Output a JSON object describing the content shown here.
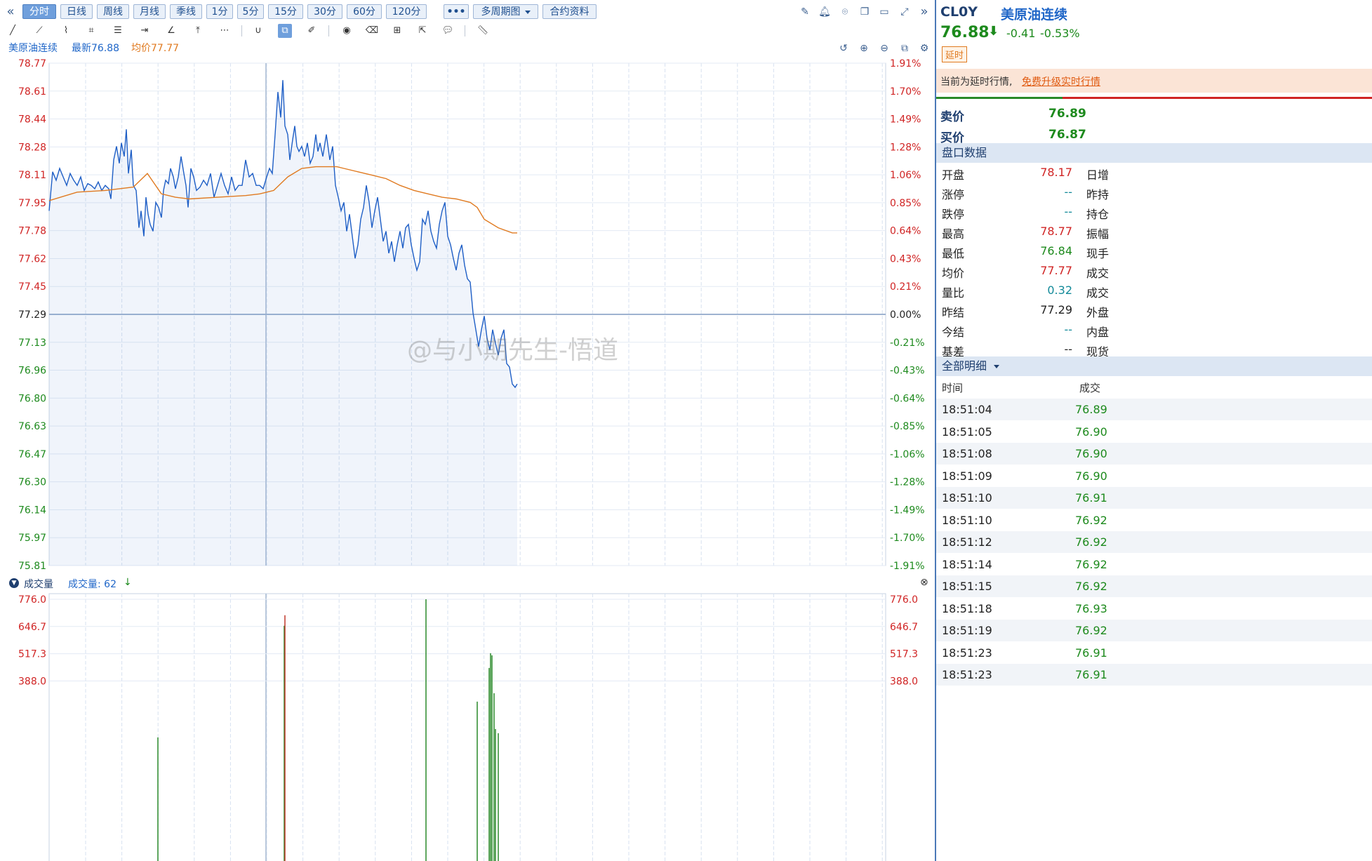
{
  "toolbar": {
    "periods": [
      "分时",
      "日线",
      "周线",
      "月线",
      "季线",
      "1分",
      "5分",
      "15分",
      "30分",
      "60分",
      "120分"
    ],
    "active_period": "分时",
    "more_label": "•••",
    "multi_period_label": "多周期图",
    "contract_info_label": "合约资料",
    "collapse_glyph": "«",
    "expand_glyph": "»"
  },
  "legend": {
    "symbol_name": "美原油连续",
    "latest_label": "最新76.88",
    "avg_label": "均价77.77"
  },
  "price_axis": {
    "left": [
      "78.77",
      "78.61",
      "78.44",
      "78.28",
      "78.11",
      "77.95",
      "77.78",
      "77.62",
      "77.45",
      "77.29",
      "77.13",
      "76.96",
      "76.80",
      "76.63",
      "76.47",
      "76.30",
      "76.14",
      "75.97",
      "75.81"
    ],
    "right": [
      "1.91%",
      "1.70%",
      "1.49%",
      "1.28%",
      "1.06%",
      "0.85%",
      "0.64%",
      "0.43%",
      "0.21%",
      "0.00%",
      "-0.21%",
      "-0.43%",
      "-0.64%",
      "-0.85%",
      "-1.06%",
      "-1.28%",
      "-1.49%",
      "-1.70%",
      "-1.91%"
    ]
  },
  "volume": {
    "title": "成交量",
    "current_label": "成交量: 62",
    "axis_left": [
      "776.0",
      "646.7",
      "517.3",
      "388.0"
    ],
    "axis_right": [
      "776.0",
      "646.7",
      "517.3",
      "388.0"
    ]
  },
  "watermark": "@与小期先生-悟道",
  "chart_data": {
    "type": "line",
    "series": [
      {
        "name": "最新",
        "color": "#1f5fc6"
      },
      {
        "name": "均价",
        "color": "#e07a20"
      }
    ],
    "prev_settle": 77.29,
    "ylim": [
      75.81,
      78.77
    ],
    "price_x": [
      0,
      5,
      10,
      15,
      20,
      25,
      30,
      35,
      40,
      45,
      50,
      55,
      60,
      65,
      70,
      75,
      80,
      85,
      88,
      92,
      96,
      100,
      103,
      107,
      110,
      113,
      117,
      120,
      124,
      128,
      131,
      135,
      138,
      141,
      144,
      148,
      152,
      156,
      160,
      163,
      166,
      170,
      173,
      177,
      180,
      184,
      188,
      192,
      195,
      198,
      202,
      206,
      210,
      215,
      220,
      225,
      230,
      235,
      240,
      245,
      250,
      255,
      260,
      265,
      270,
      275,
      280,
      285,
      290,
      295,
      300,
      305,
      310,
      320,
      330,
      340,
      350,
      360,
      370,
      380,
      390,
      400,
      410,
      420,
      430,
      440,
      450,
      460,
      470,
      480,
      490,
      500,
      510,
      520,
      530,
      540,
      550,
      560,
      570,
      580,
      590,
      600,
      610,
      620,
      630,
      640,
      650,
      660,
      665
    ],
    "price": [
      77.9,
      78.13,
      78.08,
      78.15,
      78.1,
      78.05,
      78.12,
      78.08,
      78.05,
      78.1,
      78.02,
      78.06,
      78.05,
      78.03,
      78.07,
      78.02,
      78.05,
      78.03,
      77.97,
      78.2,
      78.28,
      78.18,
      78.3,
      78.22,
      78.38,
      78.12,
      78.26,
      78.05,
      78.02,
      77.8,
      77.9,
      77.75,
      77.98,
      77.88,
      77.82,
      77.78,
      77.95,
      77.92,
      77.86,
      78.02,
      78.08,
      78.06,
      78.15,
      78.1,
      78.03,
      78.1,
      78.22,
      78.12,
      78.05,
      77.92,
      78.15,
      78.1,
      78.02,
      78.04,
      78.08,
      78.05,
      78.12,
      77.98,
      78.05,
      78.12,
      78.05,
      78.0,
      78.1,
      78.02,
      78.05,
      78.05,
      78.2,
      78.1,
      78.12,
      78.05,
      78.05,
      78.03,
      78.05,
      78.02,
      78.05,
      78.03,
      78.08,
      78.02,
      78.05,
      78.1,
      78.05,
      78.2,
      78.12,
      78.05,
      78.03,
      78.0,
      77.95,
      77.9,
      77.85,
      77.8,
      77.75,
      77.7,
      77.68,
      77.65,
      77.6,
      77.55,
      77.5,
      77.45,
      77.4,
      77.3,
      77.2,
      77.1,
      77.0,
      76.95,
      76.9,
      76.88,
      76.86,
      76.88,
      76.88
    ],
    "price_detail": [
      [
        300,
        78.05
      ],
      [
        305,
        78.03
      ],
      [
        310,
        78.1
      ],
      [
        314,
        78.15
      ],
      [
        318,
        78.12
      ],
      [
        322,
        78.35
      ],
      [
        326,
        78.6
      ],
      [
        330,
        78.45
      ],
      [
        333,
        78.67
      ],
      [
        336,
        78.4
      ],
      [
        340,
        78.35
      ],
      [
        343,
        78.2
      ],
      [
        347,
        78.32
      ],
      [
        350,
        78.4
      ],
      [
        353,
        78.28
      ],
      [
        356,
        78.25
      ],
      [
        360,
        78.28
      ],
      [
        364,
        78.22
      ],
      [
        368,
        78.3
      ],
      [
        372,
        78.18
      ],
      [
        376,
        78.22
      ],
      [
        380,
        78.35
      ],
      [
        383,
        78.25
      ],
      [
        386,
        78.3
      ],
      [
        390,
        78.22
      ],
      [
        395,
        78.35
      ],
      [
        400,
        78.2
      ],
      [
        404,
        78.28
      ],
      [
        408,
        78.05
      ],
      [
        412,
        77.98
      ],
      [
        416,
        77.9
      ],
      [
        420,
        77.95
      ],
      [
        424,
        77.78
      ],
      [
        428,
        77.88
      ],
      [
        432,
        77.75
      ],
      [
        436,
        77.62
      ],
      [
        440,
        77.7
      ],
      [
        444,
        77.85
      ],
      [
        448,
        77.92
      ],
      [
        452,
        78.05
      ],
      [
        456,
        77.95
      ],
      [
        460,
        77.8
      ],
      [
        464,
        77.9
      ],
      [
        468,
        77.98
      ],
      [
        472,
        77.85
      ],
      [
        476,
        77.72
      ],
      [
        480,
        77.78
      ],
      [
        484,
        77.65
      ],
      [
        488,
        77.72
      ],
      [
        492,
        77.6
      ],
      [
        496,
        77.7
      ],
      [
        500,
        77.78
      ],
      [
        504,
        77.68
      ],
      [
        508,
        77.8
      ],
      [
        512,
        77.82
      ],
      [
        516,
        77.7
      ],
      [
        520,
        77.62
      ],
      [
        524,
        77.55
      ],
      [
        528,
        77.6
      ],
      [
        532,
        77.85
      ],
      [
        536,
        77.82
      ],
      [
        540,
        77.9
      ],
      [
        544,
        77.78
      ],
      [
        548,
        77.72
      ],
      [
        552,
        77.68
      ],
      [
        556,
        77.82
      ],
      [
        560,
        77.9
      ],
      [
        564,
        77.95
      ],
      [
        568,
        77.75
      ],
      [
        572,
        77.7
      ],
      [
        576,
        77.62
      ],
      [
        580,
        77.55
      ],
      [
        584,
        77.65
      ],
      [
        588,
        77.7
      ],
      [
        592,
        77.58
      ],
      [
        596,
        77.5
      ],
      [
        600,
        77.48
      ],
      [
        604,
        77.3
      ],
      [
        608,
        77.2
      ],
      [
        612,
        77.1
      ],
      [
        616,
        77.2
      ],
      [
        620,
        77.28
      ],
      [
        624,
        77.15
      ],
      [
        628,
        77.08
      ],
      [
        632,
        77.2
      ],
      [
        636,
        77.12
      ],
      [
        640,
        77.05
      ],
      [
        644,
        77.15
      ],
      [
        648,
        77.2
      ],
      [
        652,
        77.0
      ],
      [
        656,
        76.98
      ],
      [
        660,
        76.88
      ],
      [
        664,
        76.86
      ],
      [
        667,
        76.88
      ]
    ],
    "avg_x": [
      0,
      40,
      80,
      120,
      140,
      160,
      180,
      200,
      240,
      280,
      300,
      320,
      340,
      360,
      380,
      400,
      410,
      420,
      440,
      460,
      480,
      500,
      520,
      540,
      560,
      580,
      600,
      610,
      620,
      640,
      660,
      667
    ],
    "avg": [
      77.96,
      78.01,
      78.02,
      78.04,
      78.12,
      78.0,
      77.98,
      77.97,
      77.98,
      77.99,
      78.0,
      78.02,
      78.1,
      78.15,
      78.16,
      78.16,
      78.16,
      78.15,
      78.13,
      78.11,
      78.09,
      78.05,
      78.02,
      78.0,
      77.98,
      77.97,
      77.95,
      77.92,
      77.85,
      77.8,
      77.77,
      77.77
    ],
    "volume_bars": [
      [
        155,
        120
      ],
      [
        335,
        650
      ],
      [
        336,
        700
      ],
      [
        537,
        776
      ],
      [
        610,
        290
      ],
      [
        627,
        450
      ],
      [
        629,
        520
      ],
      [
        631,
        510
      ],
      [
        634,
        330
      ],
      [
        636,
        160
      ],
      [
        640,
        140
      ]
    ],
    "volume_ylim": [
      0,
      776
    ]
  },
  "panel": {
    "code": "CL0Y",
    "name": "美原油连续",
    "price": "76.88",
    "change": "-0.41",
    "change_pct": "-0.53%",
    "delay_badge": "延时",
    "delay_notice": "当前为延时行情,",
    "upgrade_link": "免费升级实时行情",
    "ask_label": "卖价",
    "ask": "76.89",
    "bid_label": "买价",
    "bid": "76.87",
    "quote_section": "盘口数据",
    "quote_rows": [
      {
        "label": "开盘",
        "value": "78.17",
        "color": "red",
        "right": "日增"
      },
      {
        "label": "涨停",
        "value": "--",
        "color": "teal",
        "right": "昨持"
      },
      {
        "label": "跌停",
        "value": "--",
        "color": "teal",
        "right": "持仓"
      },
      {
        "label": "最高",
        "value": "78.77",
        "color": "red",
        "right": "振幅"
      },
      {
        "label": "最低",
        "value": "76.84",
        "color": "green",
        "right": "现手"
      },
      {
        "label": "均价",
        "value": "77.77",
        "color": "red",
        "right": "成交"
      },
      {
        "label": "量比",
        "value": "0.32",
        "color": "teal",
        "right": "成交"
      },
      {
        "label": "昨结",
        "value": "77.29",
        "color": "black",
        "right": "外盘"
      },
      {
        "label": "今结",
        "value": "--",
        "color": "teal",
        "right": "内盘"
      },
      {
        "label": "基差",
        "value": "--",
        "color": "black",
        "right": "现货"
      }
    ],
    "detail_section": "全部明细",
    "detail_header_time": "时间",
    "detail_header_price": "成交",
    "trades": [
      {
        "time": "18:51:04",
        "price": "76.89"
      },
      {
        "time": "18:51:05",
        "price": "76.90"
      },
      {
        "time": "18:51:08",
        "price": "76.90"
      },
      {
        "time": "18:51:09",
        "price": "76.90"
      },
      {
        "time": "18:51:10",
        "price": "76.91"
      },
      {
        "time": "18:51:10",
        "price": "76.92"
      },
      {
        "time": "18:51:12",
        "price": "76.92"
      },
      {
        "time": "18:51:14",
        "price": "76.92"
      },
      {
        "time": "18:51:15",
        "price": "76.92"
      },
      {
        "time": "18:51:18",
        "price": "76.93"
      },
      {
        "time": "18:51:19",
        "price": "76.92"
      },
      {
        "time": "18:51:23",
        "price": "76.91"
      },
      {
        "time": "18:51:23",
        "price": "76.91"
      }
    ]
  }
}
